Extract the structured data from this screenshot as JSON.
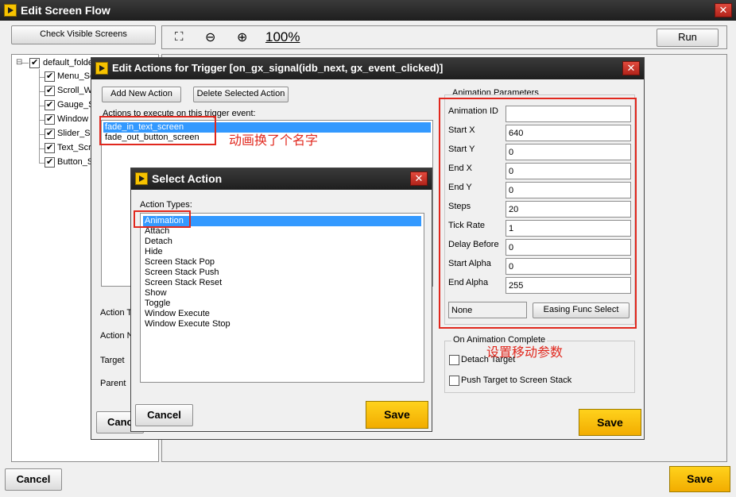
{
  "main_window": {
    "title": "Edit Screen Flow",
    "close": "✕",
    "check_visible": "Check Visible Screens",
    "zoom_level": "100%",
    "run": "Run",
    "cancel": "Cancel",
    "save": "Save",
    "tree": {
      "root": "default_folder",
      "items": [
        "Menu_Sc",
        "Scroll_W",
        "Gauge_S",
        "Window",
        "Slider_S",
        "Text_Scr",
        "Button_S"
      ]
    }
  },
  "trigger_dialog": {
    "title": "Edit Actions for Trigger [on_gx_signal(idb_next, gx_event_clicked)]",
    "close": "✕",
    "add_action": "Add New Action",
    "delete_action": "Delete Selected Action",
    "actions_label": "Actions to execute on this trigger event:",
    "actions": [
      "fade_in_text_screen",
      "fade_out_button_screen"
    ],
    "left_labels": [
      "Action T",
      "Action N",
      "Target",
      "Parent"
    ],
    "cancel_partial": "Canc",
    "save": "Save",
    "anim_params_title": "Animation Parameters",
    "params": [
      {
        "label": "Animation ID",
        "value": ""
      },
      {
        "label": "Start X",
        "value": "640"
      },
      {
        "label": "Start Y",
        "value": "0"
      },
      {
        "label": "End X",
        "value": "0"
      },
      {
        "label": "End Y",
        "value": "0"
      },
      {
        "label": "Steps",
        "value": "20"
      },
      {
        "label": "Tick Rate",
        "value": "1"
      },
      {
        "label": "Delay Before",
        "value": "0"
      },
      {
        "label": "Start Alpha",
        "value": "0"
      },
      {
        "label": "End Alpha",
        "value": "255"
      }
    ],
    "easing_value": "None",
    "easing_button": "Easing Func Select",
    "on_complete_title": "On Animation Complete",
    "detach_target": "Detach Target",
    "push_target": "Push Target to Screen Stack"
  },
  "select_dialog": {
    "title": "Select Action",
    "close": "✕",
    "types_label": "Action Types:",
    "types": [
      "Animation",
      "Attach",
      "Detach",
      "Hide",
      "Screen Stack Pop",
      "Screen Stack Push",
      "Screen Stack Reset",
      "Show",
      "Toggle",
      "Window Execute",
      "Window Execute Stop"
    ],
    "cancel": "Cancel",
    "save": "Save"
  },
  "annotations": {
    "rename": "动画换了个名字",
    "params": "设置移动参数"
  },
  "colors": {
    "title_bar": "#2b2b2b",
    "accent_yellow": "#f7c300",
    "annotation_red": "#e1281e",
    "selection_blue": "#3399ff"
  }
}
